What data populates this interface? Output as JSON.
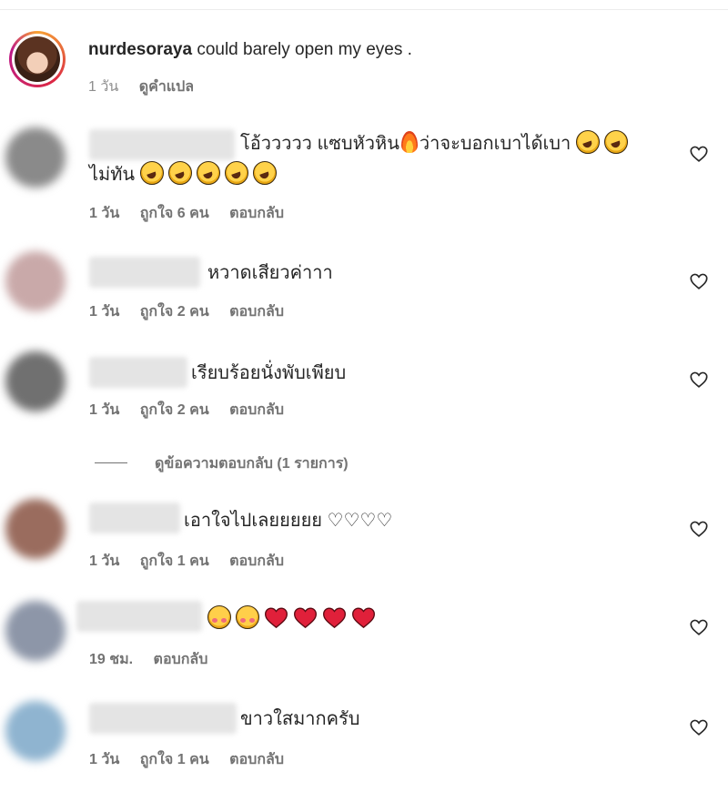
{
  "caption": {
    "username": "nurdesoraya",
    "text": " could barely open my eyes .",
    "time": "1 วัน",
    "translate": "ดูคำแปล"
  },
  "comments": [
    {
      "line1": "โอ้ววววว แซบหัวหิน",
      "line1b": "ว่าจะบอกเบาได้เบา",
      "line2": "ไม่ทัน",
      "time": "1 วัน",
      "likes": "ถูกใจ 6 คน",
      "reply": "ตอบกลับ",
      "avatar_color": "#8a8a8a"
    },
    {
      "text": "หวาดเสียวค่าาา",
      "time": "1 วัน",
      "likes": "ถูกใจ 2 คน",
      "reply": "ตอบกลับ",
      "avatar_color": "#c9a9a9"
    },
    {
      "text": "เรียบร้อยนั่งพับเพียบ",
      "time": "1 วัน",
      "likes": "ถูกใจ 2 คน",
      "reply": "ตอบกลับ",
      "avatar_color": "#707070"
    },
    {
      "text": "เอาใจไปเลยยยยย ♡♡♡♡",
      "time": "1 วัน",
      "likes": "ถูกใจ 1 คน",
      "reply": "ตอบกลับ",
      "avatar_color": "#9a6c5e"
    },
    {
      "time": "19 ชม.",
      "reply": "ตอบกลับ",
      "avatar_color": "#8d96a8"
    },
    {
      "text": "ขาวใสมากครับ",
      "time": "1 วัน",
      "likes": "ถูกใจ 1 คน",
      "reply": "ตอบกลับ",
      "avatar_color": "#8fb4d0"
    }
  ],
  "view_replies": "ดูข้อความตอบกลับ (1 รายการ)",
  "icons": {
    "like": "heart-outline-icon",
    "laugh_emoji": "rolling-on-floor-laughing-emoji",
    "fire_emoji": "fire-emoji",
    "love_emoji": "smiling-face-with-hearts-emoji",
    "red_heart_emoji": "red-heart-emoji"
  }
}
